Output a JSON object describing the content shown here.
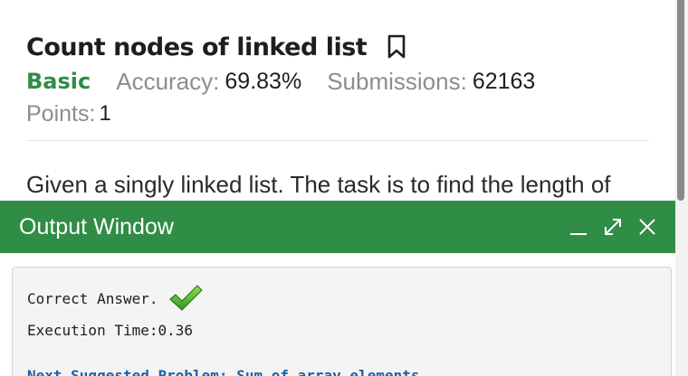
{
  "problem": {
    "title": "Count nodes of linked list",
    "difficulty": "Basic",
    "accuracy_label": "Accuracy:",
    "accuracy_value": "69.83%",
    "submissions_label": "Submissions:",
    "submissions_value": "62163",
    "points_label": "Points:",
    "points_value": "1",
    "description_start": "Given a singly linked list. The task is to find the length of"
  },
  "output_window": {
    "title": "Output Window",
    "result": "Correct Answer.",
    "execution_time": "Execution Time:0.36",
    "next_label": "Next Suggested Problem:",
    "next_problem": "Sum of array  elements"
  },
  "colors": {
    "brand_green": "#2f8d46",
    "link_blue": "#1565a8"
  },
  "icons": {
    "bookmark": "bookmark-icon",
    "minimize": "minimize-icon",
    "maximize": "maximize-icon",
    "close": "close-icon",
    "check": "checkmark-icon"
  }
}
